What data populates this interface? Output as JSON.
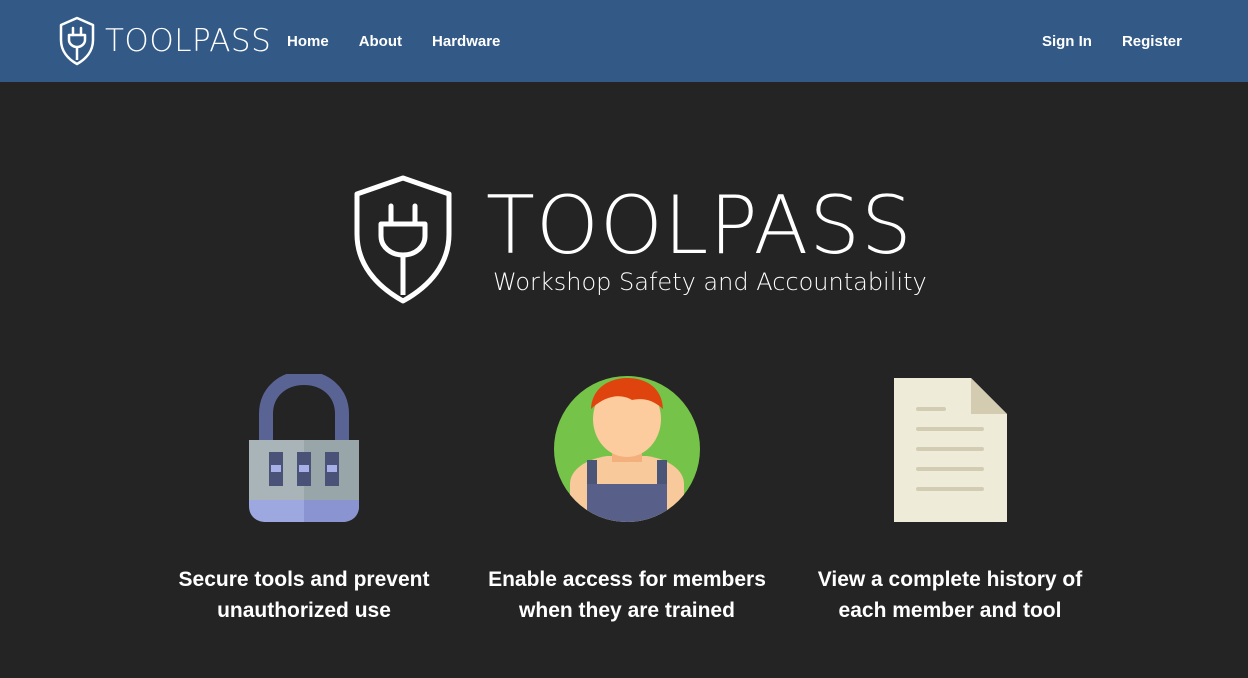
{
  "nav": {
    "brand": "TOOLPASS",
    "links": [
      "Home",
      "About",
      "Hardware"
    ],
    "auth": {
      "sign_in": "Sign In",
      "register": "Register"
    }
  },
  "hero": {
    "title": "TOOLPASS",
    "subtitle": "Workshop Safety and Accountability"
  },
  "features": [
    {
      "icon": "padlock-icon",
      "line1": "Secure tools and prevent",
      "line2": "unauthorized use"
    },
    {
      "icon": "member-icon",
      "line1": "Enable access for members",
      "line2": "when they are trained"
    },
    {
      "icon": "document-icon",
      "line1": "View a complete history of",
      "line2": "each member and tool"
    }
  ],
  "colors": {
    "navbar": "#335a87",
    "background": "#242424",
    "text": "#ffffff"
  }
}
